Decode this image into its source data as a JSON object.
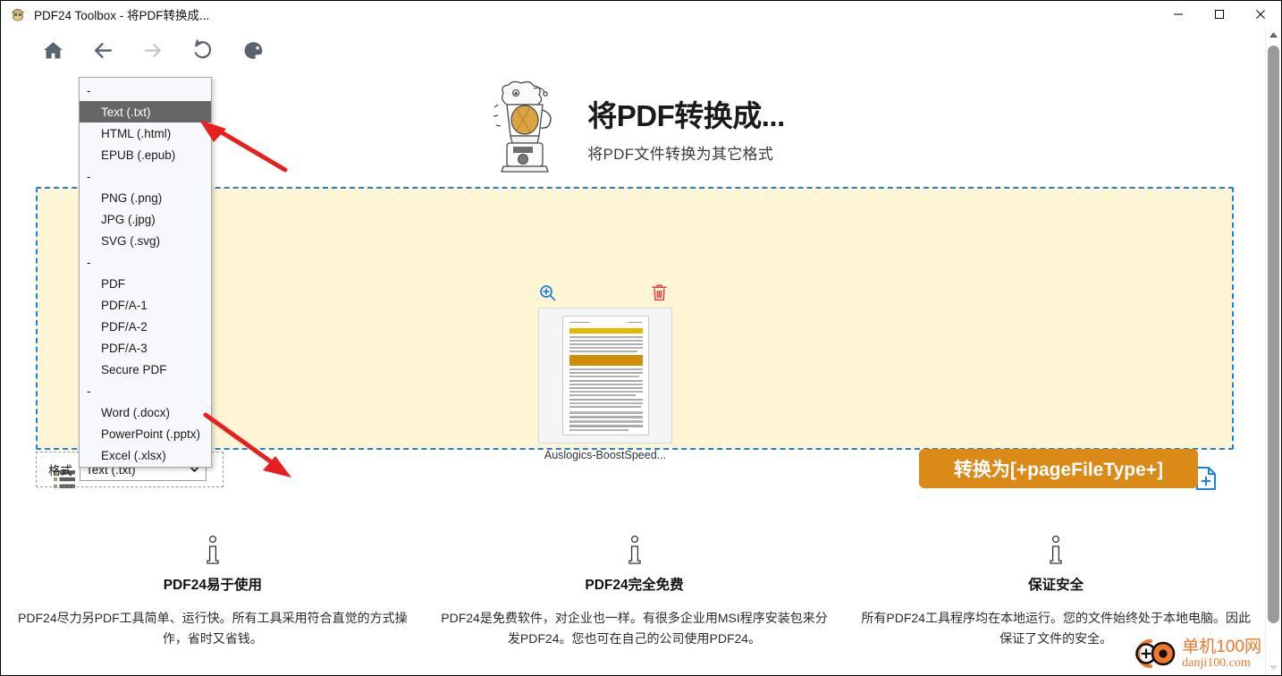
{
  "window": {
    "title": "PDF24 Toolbox - 将PDF转换成...",
    "icon": "pdf24-app-icon",
    "controls": {
      "minimize": "—",
      "maximize": "□",
      "close": "✕"
    }
  },
  "toolbar": {
    "buttons": [
      {
        "name": "home-icon",
        "label": "Home"
      },
      {
        "name": "back-arrow-icon",
        "label": "Back"
      },
      {
        "name": "forward-arrow-icon",
        "label": "Forward"
      },
      {
        "name": "reload-icon",
        "label": "Reload"
      },
      {
        "name": "palette-icon",
        "label": "Theme"
      }
    ]
  },
  "hero": {
    "illustration": "blender-mascot-icon",
    "title": "将PDF转换成...",
    "subtitle": "将PDF文件转换为其它格式"
  },
  "dropzone": {
    "list_icon": "list-view-icon",
    "add_icon": "add-file-icon",
    "file": {
      "zoom_icon": "magnifier-plus-icon",
      "delete_icon": "trash-icon",
      "name": "Auslogics-BoostSpeed..."
    }
  },
  "format_row": {
    "label": "格式",
    "selected": "Text (.txt)",
    "caret": "⌄"
  },
  "dropdown": {
    "items": [
      {
        "label": "-",
        "type": "separator"
      },
      {
        "label": "Text (.txt)",
        "type": "item",
        "selected": true
      },
      {
        "label": "HTML (.html)",
        "type": "item",
        "selected": false
      },
      {
        "label": "EPUB (.epub)",
        "type": "item",
        "selected": false
      },
      {
        "label": "-",
        "type": "separator"
      },
      {
        "label": "PNG (.png)",
        "type": "item",
        "selected": false
      },
      {
        "label": "JPG (.jpg)",
        "type": "item",
        "selected": false
      },
      {
        "label": "SVG (.svg)",
        "type": "item",
        "selected": false
      },
      {
        "label": "-",
        "type": "separator"
      },
      {
        "label": "PDF",
        "type": "item",
        "selected": false
      },
      {
        "label": "PDF/A-1",
        "type": "item",
        "selected": false
      },
      {
        "label": "PDF/A-2",
        "type": "item",
        "selected": false
      },
      {
        "label": "PDF/A-3",
        "type": "item",
        "selected": false
      },
      {
        "label": "Secure PDF",
        "type": "item",
        "selected": false
      },
      {
        "label": "-",
        "type": "separator"
      },
      {
        "label": "Word (.docx)",
        "type": "item",
        "selected": false
      },
      {
        "label": "PowerPoint (.pptx)",
        "type": "item",
        "selected": false
      },
      {
        "label": "Excel (.xlsx)",
        "type": "item",
        "selected": false
      }
    ]
  },
  "convert_button": {
    "label": "转换为[+pageFileType+]"
  },
  "features": [
    {
      "icon": "info-icon",
      "title": "PDF24易于使用",
      "desc": "PDF24尽力另PDF工具简单、运行快。所有工具采用符合直觉的方式操作，省时又省钱。"
    },
    {
      "icon": "info-icon",
      "title": "PDF24完全免费",
      "desc": "PDF24是免费软件，对企业也一样。有很多企业用MSI程序安装包来分发PDF24。您也可在自己的公司使用PDF24。"
    },
    {
      "icon": "info-icon",
      "title": "保证安全",
      "desc": "所有PDF24工具程序均在本地运行。您的文件始终处于本地电脑。因此保证了文件的安全。"
    }
  ],
  "watermark": {
    "line1": "单机100网",
    "line2": "danji100.com"
  },
  "colors": {
    "accent_orange": "#da8a16",
    "dropzone_bg": "#fdf5d4",
    "dropzone_border": "#1a82e2",
    "selection_gray": "#666666",
    "annotation_red": "#e81f1f",
    "watermark_orange": "#f2772a"
  },
  "scrollbar": {
    "up_arrow": "▲",
    "down_arrow": "▼"
  }
}
